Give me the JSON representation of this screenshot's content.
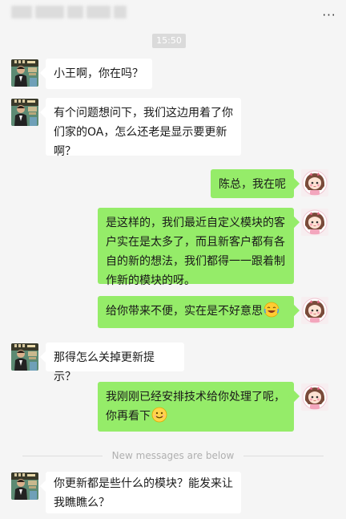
{
  "header": {
    "title": "",
    "more_label": "···"
  },
  "timestamp": "15:50",
  "divider": "New messages are below",
  "messages": [
    {
      "side": "in",
      "text": "小王啊，你在吗？"
    },
    {
      "side": "in",
      "text": "有个问题想问下，我们这边用着了你们家的OA，怎么还老是显示要更新啊？"
    },
    {
      "side": "out",
      "text": "陈总，我在呢"
    },
    {
      "side": "out",
      "text": "是这样的，我们最近自定义模块的客户实在是太多了，而且新客户都有各自的新的想法，我们都得一一跟着制作新的模块的呀。"
    },
    {
      "side": "out",
      "text": "给你带来不便，实在是不好意思",
      "emoji": "laugh-cry-emoji"
    },
    {
      "side": "in",
      "text": "那得怎么关掉更新提示？"
    },
    {
      "side": "out",
      "text": "我刚刚已经安排技术给你处理了呢，你再看下",
      "emoji": "smile-emoji"
    },
    {
      "side": "in",
      "text": "你更新都是些什么的模块？能发来让我瞧瞧么？"
    }
  ],
  "colors": {
    "background": "#f5f5f5",
    "incoming_bubble": "#ffffff",
    "outgoing_bubble": "#95ec69",
    "time_pill": "#dadada"
  }
}
